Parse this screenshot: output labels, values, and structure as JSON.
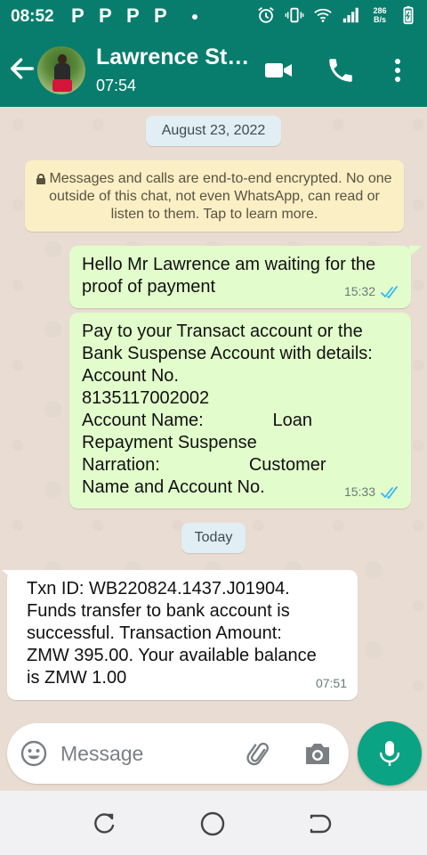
{
  "status_bar": {
    "time": "08:52",
    "notifications": [
      "P",
      "P",
      "P",
      "P"
    ],
    "network_speed_value": "286",
    "network_speed_unit": "B/s",
    "icons": [
      "alarm-icon",
      "vibrate-icon",
      "wifi-icon",
      "signal-icon",
      "battery-icon"
    ]
  },
  "header": {
    "contact_name": "Lawrence St…",
    "subtitle": "07:54",
    "icons": [
      "back-arrow-icon",
      "video-call-icon",
      "phone-icon",
      "more-vert-icon"
    ]
  },
  "chat": {
    "date_label": "August 23, 2022",
    "encryption_notice": "Messages and calls are end-to-end encrypted. No one outside of this chat, not even WhatsApp, can read or listen to them. Tap to learn more.",
    "messages": [
      {
        "direction": "outgoing",
        "text": "Hello Mr Lawrence am waiting for the\nproof of payment",
        "time": "15:32",
        "status": "read"
      },
      {
        "direction": "outgoing",
        "text": "Pay to your Transact account or the\nBank Suspense Account with details:\nAccount No.\n8135117002002\nAccount Name:              Loan\nRepayment Suspense\nNarration:                  Customer\nName and Account No.",
        "time": "15:33",
        "status": "read"
      }
    ],
    "today_label": "Today",
    "incoming": [
      {
        "direction": "incoming",
        "text": "Txn ID: WB220824.1437.J01904.\nFunds transfer to bank account is\nsuccessful. Transaction Amount:\nZMW 395.00. Your available balance\nis ZMW 1.00",
        "time": "07:51"
      }
    ]
  },
  "input_bar": {
    "placeholder": "Message",
    "value": "",
    "icons": [
      "emoji-icon",
      "attach-icon",
      "camera-icon",
      "mic-icon"
    ]
  },
  "colors": {
    "header": "#087d6d",
    "outgoing_bubble": "#e2fdcb",
    "incoming_bubble": "#ffffff",
    "tick_read": "#34b7f1",
    "fab": "#0aa383"
  }
}
